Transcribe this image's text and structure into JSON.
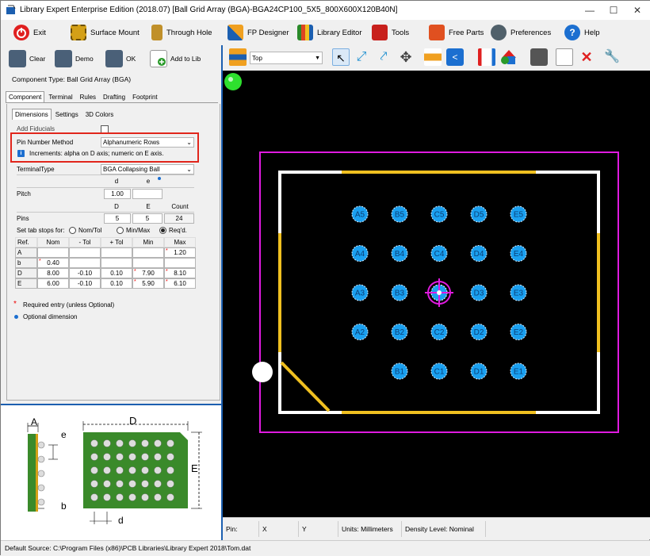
{
  "title": "Library Expert Enterprise Edition (2018.07) [Ball Grid Array (BGA)-BGA24CP100_5X5_800X600X120B40N]",
  "main_toolbar": {
    "exit": "Exit",
    "surface_mount": "Surface Mount",
    "through_hole": "Through Hole",
    "fp_designer": "FP Designer",
    "library_editor": "Library Editor",
    "tools": "Tools",
    "free_parts": "Free Parts",
    "preferences": "Preferences",
    "help": "Help"
  },
  "left_toolbar": {
    "clear": "Clear",
    "demo": "Demo",
    "ok": "OK",
    "add_to_lib": "Add to Lib"
  },
  "component_type": "Component Type: Ball Grid Array (BGA)",
  "tabs": [
    "Component",
    "Terminal",
    "Rules",
    "Drafting",
    "Footprint"
  ],
  "subtabs": [
    "Dimensions",
    "Settings",
    "3D Colors"
  ],
  "form": {
    "add_fiducials": "Add Fiducials",
    "pin_number_method_label": "Pin Number Method",
    "pin_number_method_value": "Alphanumeric Rows",
    "increments_info": "Increments: alpha on D axis; numeric on E axis.",
    "terminal_type_label": "TerminalType",
    "terminal_type_value": "BGA Collapsing Ball",
    "pitch_label": "Pitch",
    "pitch_d_header": "d",
    "pitch_e_header": "e",
    "pitch_d_value": "1.00",
    "pitch_e_value": "",
    "pins_label": "Pins",
    "pins_D_header": "D",
    "pins_E_header": "E",
    "pins_count_header": "Count",
    "pins_D": "5",
    "pins_E": "5",
    "pins_count": "24",
    "tab_stops_label": "Set tab stops for:",
    "radio_nom_tol": "Nom/Tol",
    "radio_min_max": "Min/Max",
    "radio_reqd": "Req'd.",
    "table_headers": [
      "Ref.",
      "Nom",
      "- Tol",
      "+ Tol",
      "Min",
      "Max"
    ],
    "rows": [
      {
        "ref": "A",
        "nom": "",
        "mtol": "",
        "ptol": "",
        "min": "",
        "max": "1.20"
      },
      {
        "ref": "b",
        "nom": "0.40",
        "mtol": "",
        "ptol": "",
        "min": "",
        "max": ""
      },
      {
        "ref": "D",
        "nom": "8.00",
        "mtol": "-0.10",
        "ptol": "0.10",
        "min": "7.90",
        "max": "8.10"
      },
      {
        "ref": "E",
        "nom": "6.00",
        "mtol": "-0.10",
        "ptol": "0.10",
        "min": "5.90",
        "max": "6.10"
      }
    ],
    "required_note": "Required entry (unless Optional)",
    "optional_note": "Optional dimension"
  },
  "diagram": {
    "A": "A",
    "e": "e",
    "b": "b",
    "D": "D",
    "E": "E",
    "d": "d"
  },
  "toolbar2": {
    "layer": "Top"
  },
  "pads": [
    {
      "label": "A5",
      "col": 0,
      "row": 0
    },
    {
      "label": "B5",
      "col": 1,
      "row": 0
    },
    {
      "label": "C5",
      "col": 2,
      "row": 0
    },
    {
      "label": "D5",
      "col": 3,
      "row": 0
    },
    {
      "label": "E5",
      "col": 4,
      "row": 0
    },
    {
      "label": "A4",
      "col": 0,
      "row": 1
    },
    {
      "label": "B4",
      "col": 1,
      "row": 1
    },
    {
      "label": "C4",
      "col": 2,
      "row": 1
    },
    {
      "label": "D4",
      "col": 3,
      "row": 1
    },
    {
      "label": "E4",
      "col": 4,
      "row": 1
    },
    {
      "label": "A3",
      "col": 0,
      "row": 2
    },
    {
      "label": "B3",
      "col": 1,
      "row": 2
    },
    {
      "label": "D3",
      "col": 3,
      "row": 2
    },
    {
      "label": "E3",
      "col": 4,
      "row": 2
    },
    {
      "label": "A2",
      "col": 0,
      "row": 3
    },
    {
      "label": "B2",
      "col": 1,
      "row": 3
    },
    {
      "label": "C2",
      "col": 2,
      "row": 3
    },
    {
      "label": "D2",
      "col": 3,
      "row": 3
    },
    {
      "label": "E2",
      "col": 4,
      "row": 3
    },
    {
      "label": "B1",
      "col": 1,
      "row": 4
    },
    {
      "label": "C1",
      "col": 2,
      "row": 4
    },
    {
      "label": "D1",
      "col": 3,
      "row": 4
    },
    {
      "label": "E1",
      "col": 4,
      "row": 4
    }
  ],
  "status": {
    "pin": "Pin:",
    "x": "X",
    "y": "Y",
    "units": "Units: Millimeters",
    "density": "Density Level: Nominal"
  },
  "footer": "Default Source:  C:\\Program Files (x86)\\PCB Libraries\\Library Expert 2018\\Tom.dat"
}
